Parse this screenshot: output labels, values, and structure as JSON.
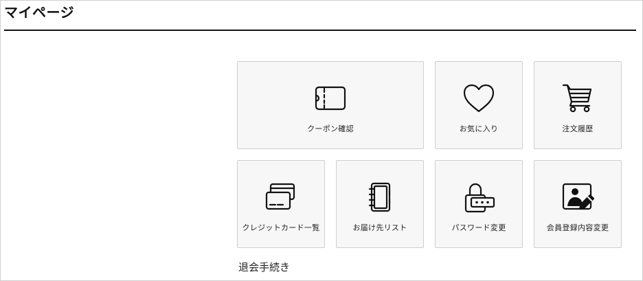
{
  "page": {
    "title": "マイページ"
  },
  "menu": {
    "tiles": [
      {
        "label": "クーポン確認",
        "icon": "coupon-icon"
      },
      {
        "label": "お気に入り",
        "icon": "heart-icon"
      },
      {
        "label": "注文履歴",
        "icon": "cart-icon"
      },
      {
        "label": "クレジットカード一覧",
        "icon": "credit-card-icon"
      },
      {
        "label": "お届け先リスト",
        "icon": "address-book-icon"
      },
      {
        "label": "パスワード変更",
        "icon": "padlock-icon"
      },
      {
        "label": "会員登録内容変更",
        "icon": "profile-edit-icon"
      }
    ]
  },
  "withdraw": {
    "label": "退会手続き"
  },
  "colors": {
    "tile_background": "#f7f7f8",
    "tile_border": "#cfcfcf",
    "text": "#111111"
  }
}
